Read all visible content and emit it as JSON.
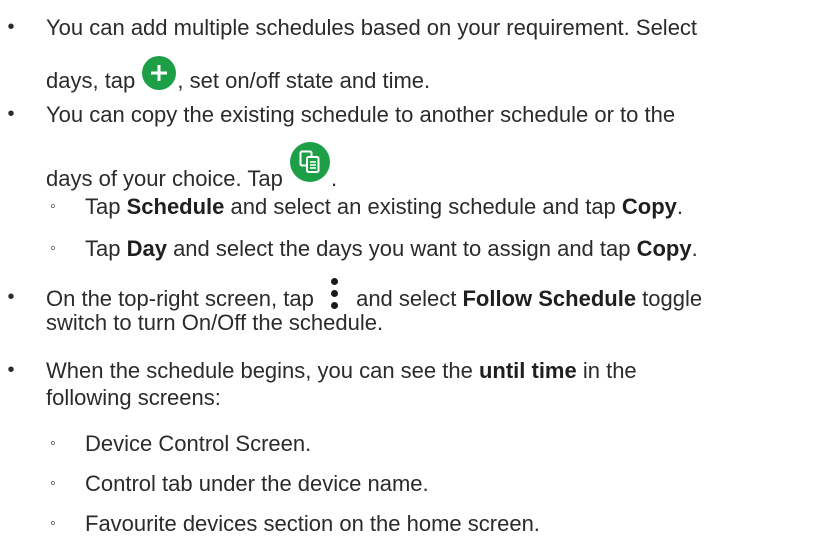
{
  "bullets": {
    "main": "•",
    "sub": "◦"
  },
  "item1": {
    "line1": "You can add multiple schedules based on your requirement. Select",
    "line2_pre": "days, tap",
    "line2_post": ", set on/off state and time.",
    "icon": "add-circle-icon"
  },
  "item2": {
    "line1": "You can copy the existing schedule to another schedule or to the",
    "line2_pre": "days of your choice. Tap",
    "line2_post": ".",
    "icon": "copy-circle-icon",
    "sub1": {
      "pre": "Tap ",
      "b1": "Schedule",
      "mid": " and select an existing schedule and tap ",
      "b2": "Copy",
      "post": "."
    },
    "sub2": {
      "pre": "Tap ",
      "b1": "Day",
      "mid": " and select the days you want to assign and tap ",
      "b2": "Copy",
      "post": "."
    }
  },
  "item3": {
    "line1_pre": "On the top-right screen, tap",
    "line1_mid": "and select ",
    "line1_bold": "Follow Schedule",
    "line1_post": " toggle",
    "line2": "switch to turn On/Off the schedule.",
    "icon": "more-vertical-icon"
  },
  "item4": {
    "line1_pre": "When the schedule begins, you can see the ",
    "line1_bold": "until time",
    "line1_post": " in the",
    "line2": "following screens:",
    "subs": [
      "Device Control Screen.",
      "Control tab under the device name.",
      "Favourite devices section on the home screen."
    ]
  },
  "colors": {
    "text": "#2b2b2b",
    "icon_green": "#1d9f48"
  }
}
